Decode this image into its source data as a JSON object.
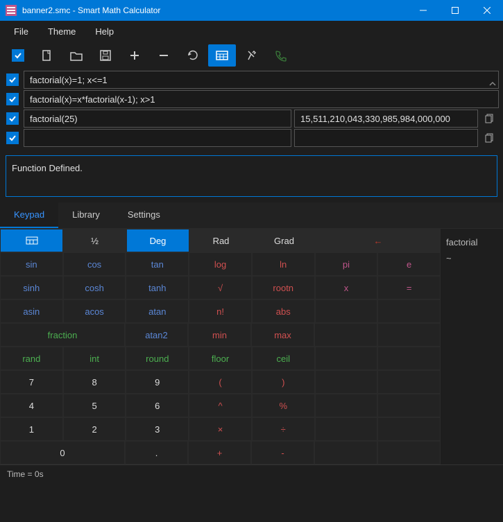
{
  "window": {
    "title": "banner2.smc - Smart Math Calculator"
  },
  "menus": {
    "file": "File",
    "theme": "Theme",
    "help": "Help"
  },
  "toolbar": {
    "check": "✓",
    "new": "new",
    "open": "open",
    "save": "save",
    "add": "add",
    "minus": "minus",
    "refresh": "refresh",
    "keypad": "keypad",
    "pin": "pin",
    "call": "call"
  },
  "rows": [
    {
      "checked": true,
      "full": true,
      "expr": "factorial(x)=1; x<=1"
    },
    {
      "checked": true,
      "full": true,
      "expr": "factorial(x)=x*factorial(x-1); x>1"
    },
    {
      "checked": true,
      "full": false,
      "expr": "factorial(25)",
      "result": "15,511,210,043,330,985,984,000,000"
    },
    {
      "checked": true,
      "full": false,
      "expr": "",
      "result": ""
    }
  ],
  "status": "Function Defined.",
  "tabs": {
    "keypad": "Keypad",
    "library": "Library",
    "settings": "Settings"
  },
  "keypad": {
    "header": [
      "",
      "½",
      "Deg",
      "Rad",
      "Grad",
      "",
      "←"
    ],
    "r1": [
      "sin",
      "cos",
      "tan",
      "log",
      "ln",
      "pi",
      "e"
    ],
    "r2": [
      "sinh",
      "cosh",
      "tanh",
      "√",
      "rootn",
      "x",
      "="
    ],
    "r3": [
      "asin",
      "acos",
      "atan",
      "n!",
      "abs",
      "",
      ""
    ],
    "r4": [
      "fraction",
      "atan2",
      "min",
      "max",
      "",
      ""
    ],
    "r5": [
      "rand",
      "int",
      "round",
      "floor",
      "ceil",
      "",
      ""
    ],
    "r6": [
      "7",
      "8",
      "9",
      "(",
      ")",
      "",
      ""
    ],
    "r7": [
      "4",
      "5",
      "6",
      "^",
      "%",
      "",
      ""
    ],
    "r8": [
      "1",
      "2",
      "3",
      "×",
      "÷",
      "",
      ""
    ],
    "r9": [
      "0",
      ".",
      "+",
      "-",
      "",
      ""
    ]
  },
  "side": {
    "line1": "factorial",
    "line2": "~"
  },
  "footer": "Time = 0s"
}
